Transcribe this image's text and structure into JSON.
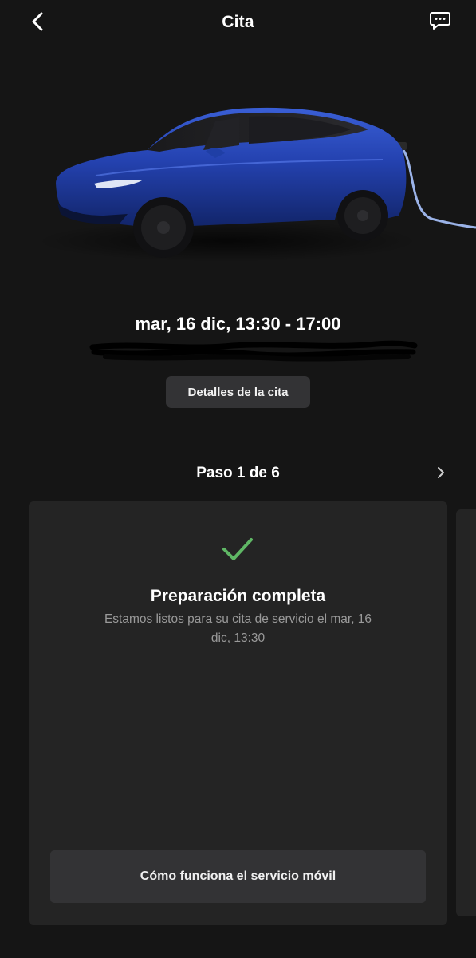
{
  "header": {
    "title": "Cita",
    "back_icon": "chevron-left-icon",
    "chat_icon": "chat-bubble-icon"
  },
  "vehicle": {
    "image": "blue-suv-charging-image",
    "color": "#1f3fa6"
  },
  "appointment": {
    "time": "mar, 16 dic, 13:30 - 17:00",
    "address_redacted": true,
    "details_button": "Detalles de la cita"
  },
  "steps": {
    "label": "Paso 1 de 6",
    "next_icon": "chevron-right-icon"
  },
  "card": {
    "status_icon": "checkmark-icon",
    "status_color": "#5fb765",
    "title": "Preparación completa",
    "description": "Estamos listos para su cita de servicio el mar, 16 dic, 13:30",
    "button": "Cómo funciona el servicio móvil"
  }
}
